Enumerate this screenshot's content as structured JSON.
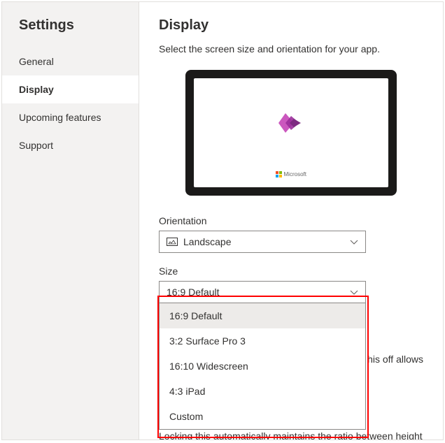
{
  "sidebar": {
    "title": "Settings",
    "items": [
      {
        "label": "General",
        "active": false
      },
      {
        "label": "Display",
        "active": true
      },
      {
        "label": "Upcoming features",
        "active": false
      },
      {
        "label": "Support",
        "active": false
      }
    ]
  },
  "main": {
    "title": "Display",
    "subtitle": "Select the screen size and orientation for your app.",
    "preview_logo_text": "Microsoft"
  },
  "orientation": {
    "label": "Orientation",
    "value": "Landscape"
  },
  "size": {
    "label": "Size",
    "value": "16:9 Default",
    "options": [
      "16:9 Default",
      "3:2 Surface Pro 3",
      "16:10 Widescreen",
      "4:3 iPad",
      "Custom"
    ]
  },
  "background_text": {
    "partial_right": "his off allows",
    "partial_bottom": "Locking this automatically maintains the ratio between height"
  }
}
